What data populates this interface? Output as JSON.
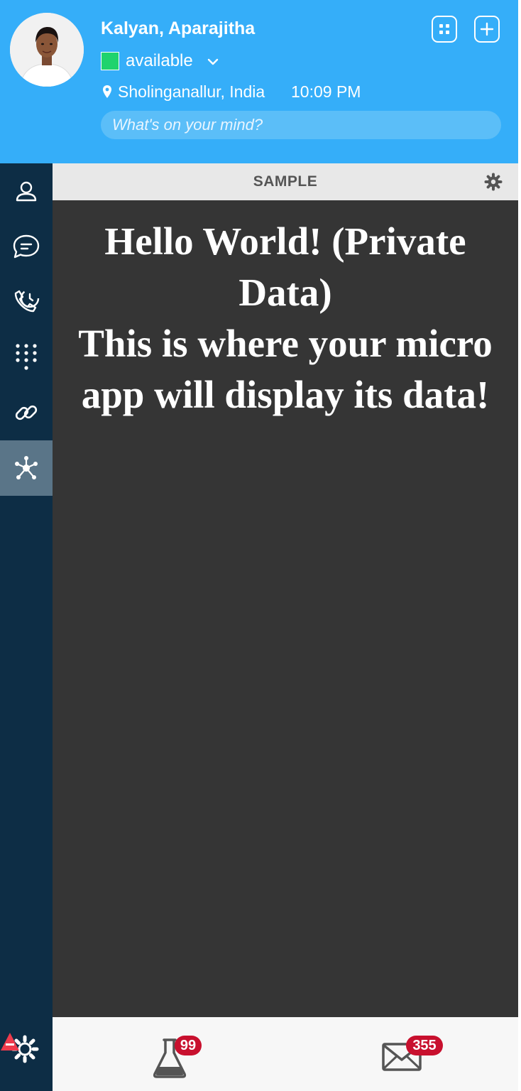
{
  "header": {
    "user_name": "Kalyan, Aparajitha",
    "status": "available",
    "location": "Sholinganallur, India",
    "time": "10:09 PM",
    "mood_placeholder": "What's on your mind?",
    "status_color": "#1fd36d",
    "background_color": "#35aef9"
  },
  "sidebar": {
    "items": [
      {
        "name": "contacts",
        "icon": "person-icon"
      },
      {
        "name": "chat",
        "icon": "chat-bubble-icon"
      },
      {
        "name": "call-history",
        "icon": "phone-clock-icon"
      },
      {
        "name": "dialpad",
        "icon": "dialpad-icon"
      },
      {
        "name": "links",
        "icon": "link-icon"
      },
      {
        "name": "micro-apps",
        "icon": "hub-icon",
        "active": true
      }
    ]
  },
  "panel": {
    "title": "SAMPLE",
    "lines": [
      "Hello World! (Private Data)",
      "This is where your micro app will display its data!"
    ]
  },
  "footer": {
    "flask_count": "99",
    "mail_count": "355",
    "badge_color": "#c8102e"
  }
}
